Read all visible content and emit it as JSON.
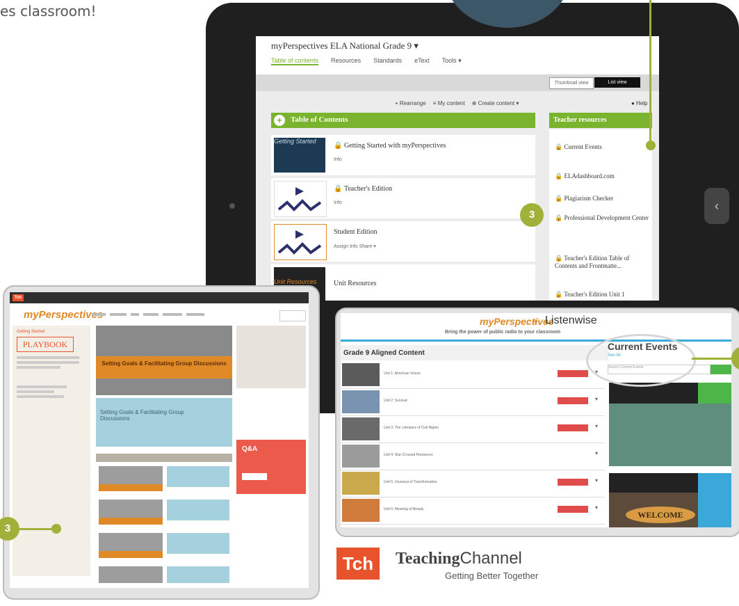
{
  "caption": "es classroom!",
  "screen1": {
    "title": "myPerspectives ELA National Grade 9 ▾",
    "nav": [
      "Table of contents",
      "Resources",
      "Standards",
      "eText",
      "Tools ▾"
    ],
    "thumbnail_view": "Thumbnail view",
    "list_view": "List view",
    "toolbar": [
      "+ Rearrange",
      "≡ My content",
      "⊕ Create content ▾"
    ],
    "help": "● Help",
    "toc_title": "Table of Contents",
    "toc_items": [
      {
        "name": "Getting Started with myPerspectives",
        "sub": "Info",
        "thumb_text": "Getting Started",
        "thumb_color": "#1d3a55"
      },
      {
        "name": "Teacher's Edition",
        "sub": "Info",
        "thumb_text": "",
        "thumb_color": "#ffffff"
      },
      {
        "name": "Student Edition",
        "sub": "Assign  Info  Share ▾",
        "thumb_text": "",
        "thumb_color": "#ffffff"
      },
      {
        "name": "Unit Resources",
        "sub": "",
        "thumb_text": "Unit Resources",
        "thumb_color": "#222222"
      }
    ],
    "teacher_resources_title": "Teacher resources",
    "teacher_resources": [
      "Current Events",
      "ELAdashboard.com",
      "Plagiarism Checker",
      "Professional Development Center",
      "Teacher's Edition Table of Contents and Frontmatte...",
      "Teacher's Edition Unit 1"
    ]
  },
  "screen2": {
    "logo": "myPerspectives",
    "getting_started": "Getting Started",
    "playbook": "PLAYBOOK",
    "hero_title": "Setting Goals & Facilitating Group Discussions",
    "blue_title": "Setting Goals & Facilitating Group Discussions",
    "qa": "Q&A"
  },
  "screen3": {
    "logo1": "myPerspectives",
    "plus": "+",
    "logo2": "Listenwise",
    "tagline": "Bring the power of public radio to your classroom",
    "grade": "Grade 9 Aligned Content",
    "rows": [
      {
        "text": "Unit 1: American Voices",
        "color": "#5b5b5b"
      },
      {
        "text": "Unit 2: Survival",
        "color": "#7a93b0"
      },
      {
        "text": "Unit 3: The Literature of Civil Rights",
        "color": "#6a6a6a"
      },
      {
        "text": "Unit 4: Star-Crossed Romances",
        "color": "#9b9b9b"
      },
      {
        "text": "Unit 5: Journeys of Transformation",
        "color": "#c9a94c"
      },
      {
        "text": "Unit 6: Meaning of Beauty",
        "color": "#d07a3c"
      }
    ],
    "events_title": "Current Events",
    "see_all": "See All",
    "search_placeholder": "Search Current Events",
    "welcome": "WELCOME"
  },
  "callouts": [
    "3",
    "3"
  ],
  "brand": {
    "box": "Tch",
    "name_part1": "Teaching",
    "name_part2": "Channel",
    "tagline": "Getting Better Together"
  }
}
